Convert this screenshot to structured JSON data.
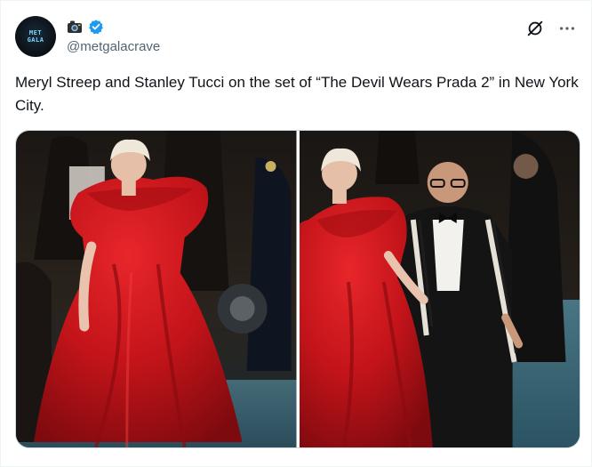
{
  "post": {
    "handle": "@metgalacrave",
    "text": "Meryl Streep and Stanley Tucci on the set of “The Devil Wears Prada 2” in New York City.",
    "badges": [
      "camera-icon",
      "verified-icon"
    ]
  },
  "colors": {
    "text": "#0f1419",
    "secondary": "#536471",
    "verified": "#1d9bf0",
    "gown": "#c8141a",
    "border": "#cfd9de"
  },
  "media": {
    "photos": [
      {
        "name": "photo-1"
      },
      {
        "name": "photo-2"
      }
    ]
  }
}
